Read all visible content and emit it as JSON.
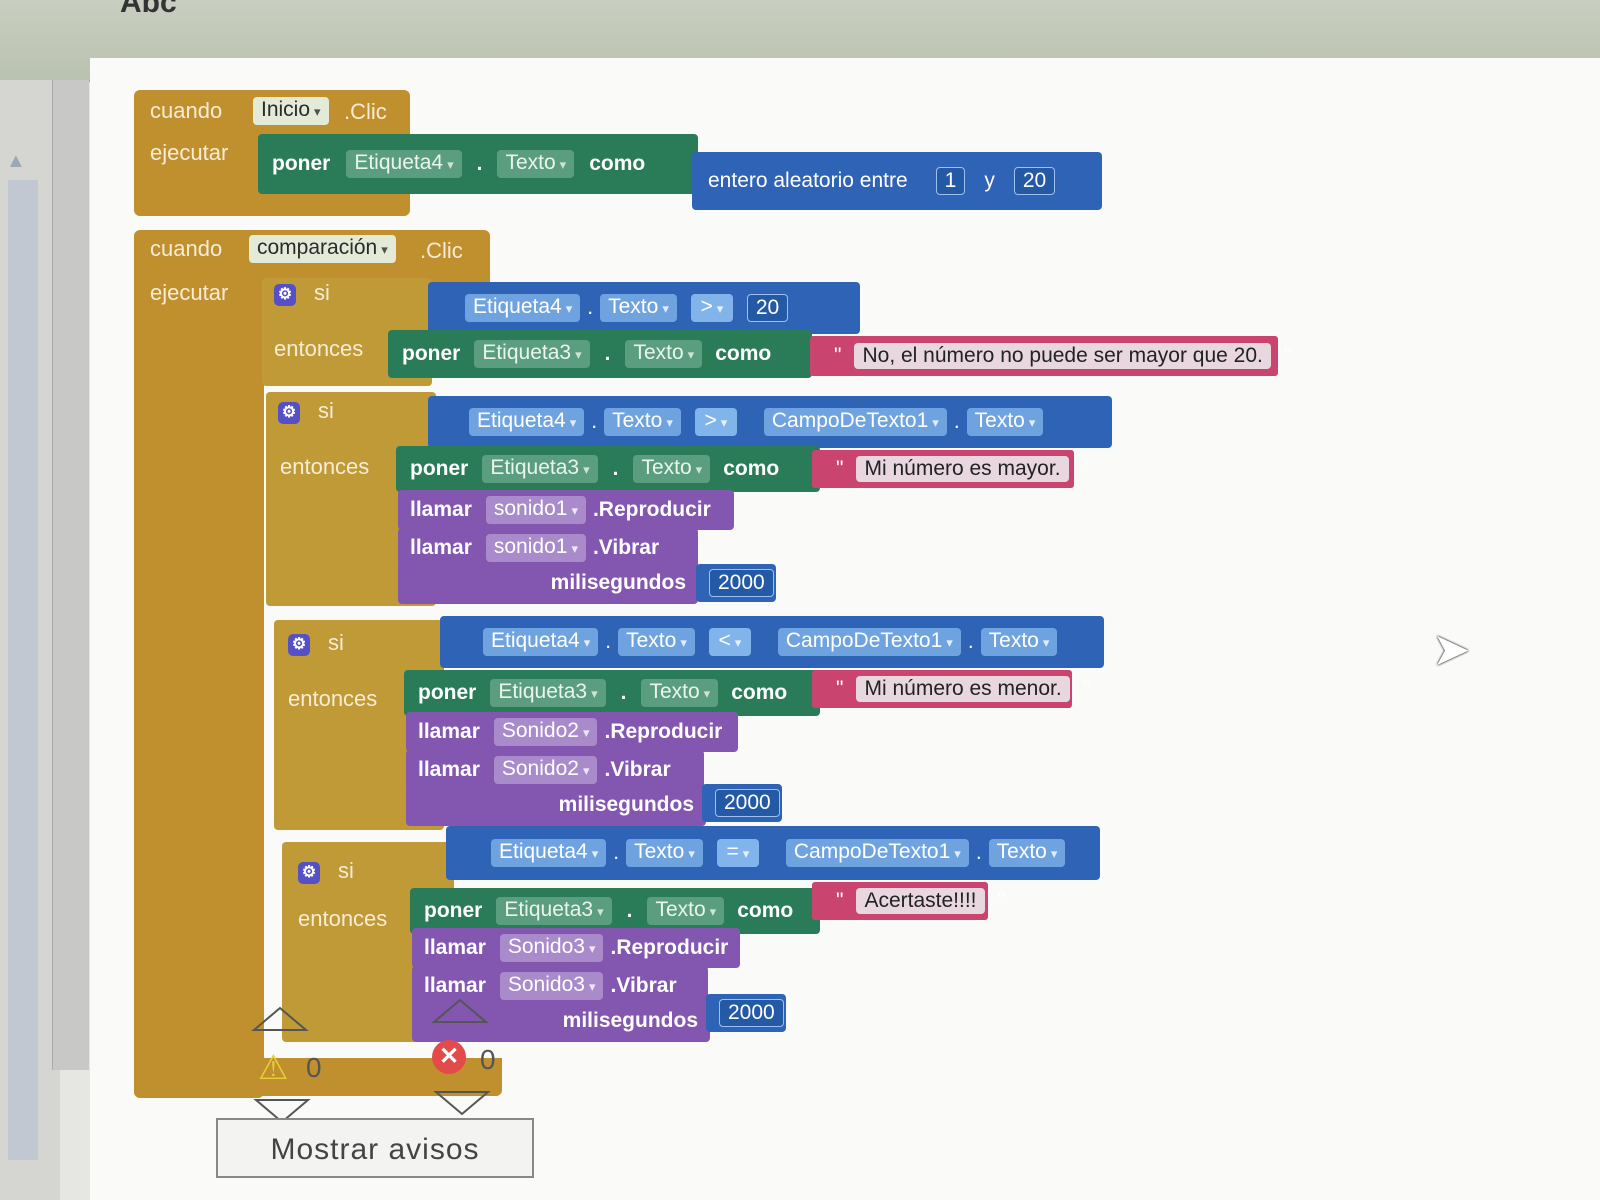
{
  "app": {
    "title": "Abc"
  },
  "blocks": {
    "b1": {
      "when": "cuando",
      "component": "Inicio",
      "event": ".Clic",
      "do": "ejecutar",
      "set": {
        "kw": "poner",
        "comp": "Etiqueta4",
        "prop": "Texto",
        "as": "como"
      },
      "math": {
        "label": "entero aleatorio entre",
        "from": "1",
        "and": "y",
        "to": "20"
      }
    },
    "b2": {
      "when": "cuando",
      "component": "comparación",
      "event": ".Clic",
      "do": "ejecutar",
      "if_kw": "si",
      "then_kw": "entonces",
      "dot": ".",
      "if1": {
        "a_comp": "Etiqueta4",
        "a_prop": "Texto",
        "op": ">",
        "b_num": "20",
        "set_kw": "poner",
        "set_comp": "Etiqueta3",
        "set_prop": "Texto",
        "as": "como",
        "text": "No, el número no puede ser mayor que 20."
      },
      "if2": {
        "a_comp": "Etiqueta4",
        "a_prop": "Texto",
        "op": ">",
        "b_comp": "CampoDeTexto1",
        "b_prop": "Texto",
        "set_kw": "poner",
        "set_comp": "Etiqueta3",
        "set_prop": "Texto",
        "as": "como",
        "text": "Mi número es mayor.",
        "call_kw": "llamar",
        "sound": "sonido1",
        "play": ".Reproducir",
        "vibrate": ".Vibrar",
        "ms_label": "milisegundos",
        "ms": "2000"
      },
      "if3": {
        "a_comp": "Etiqueta4",
        "a_prop": "Texto",
        "op": "<",
        "b_comp": "CampoDeTexto1",
        "b_prop": "Texto",
        "set_kw": "poner",
        "set_comp": "Etiqueta3",
        "set_prop": "Texto",
        "as": "como",
        "text": "Mi número es menor.",
        "call_kw": "llamar",
        "sound": "Sonido2",
        "play": ".Reproducir",
        "vibrate": ".Vibrar",
        "ms_label": "milisegundos",
        "ms": "2000"
      },
      "if4": {
        "a_comp": "Etiqueta4",
        "a_prop": "Texto",
        "op": "=",
        "b_comp": "CampoDeTexto1",
        "b_prop": "Texto",
        "set_kw": "poner",
        "set_comp": "Etiqueta3",
        "set_prop": "Texto",
        "as": "como",
        "text": "Acertaste!!!!",
        "call_kw": "llamar",
        "sound": "Sonido3",
        "play": ".Reproducir",
        "vibrate": ".Vibrar",
        "ms_label": "milisegundos",
        "ms": "2000"
      }
    }
  },
  "warnings": {
    "warn_count": "0",
    "error_count": "0",
    "show_button": "Mostrar avisos"
  },
  "colors": {
    "event": "#c0902f",
    "control": "#bf9a36",
    "setter": "#2a7c59",
    "math": "#2f63b5",
    "compare": "#3a8ad3",
    "text": "#c9446f",
    "call": "#8357b0"
  }
}
